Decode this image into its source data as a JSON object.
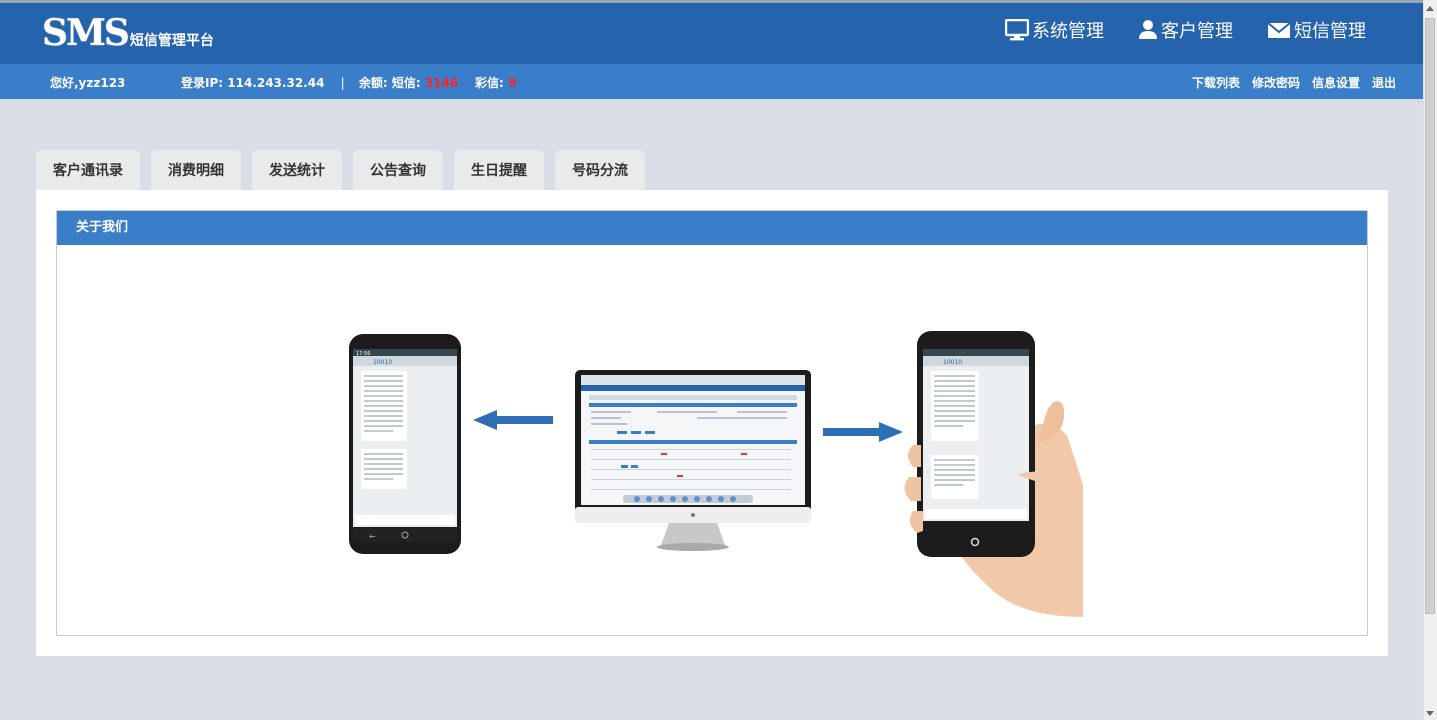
{
  "brand": {
    "logo": "SMS",
    "subtitle": "短信管理平台"
  },
  "nav": [
    {
      "label": "系统管理",
      "icon": "monitor-icon"
    },
    {
      "label": "客户管理",
      "icon": "user-icon"
    },
    {
      "label": "短信管理",
      "icon": "envelope-icon"
    }
  ],
  "user": {
    "greeting": "您好,yzz123",
    "login_ip_label": "登录IP:",
    "login_ip": "114.243.32.44",
    "separator": "|",
    "balance_label": "余额:",
    "sms_label": "短信:",
    "sms_value": "3146",
    "mms_label": "彩信:",
    "mms_value": "9"
  },
  "links": [
    "下载列表",
    "修改密码",
    "信息设置",
    "退出"
  ],
  "tabs": [
    "客户通讯录",
    "消费明细",
    "发送统计",
    "公告查询",
    "生日提醒",
    "号码分流"
  ],
  "panel": {
    "title": "关于我们"
  },
  "illustration": {
    "phone_title": "10010",
    "phone_time": "17:56"
  },
  "colors": {
    "header": "#2563ad",
    "subheader": "#3a7ec9",
    "accent_red": "#ff2020",
    "background": "#d9dee6"
  }
}
